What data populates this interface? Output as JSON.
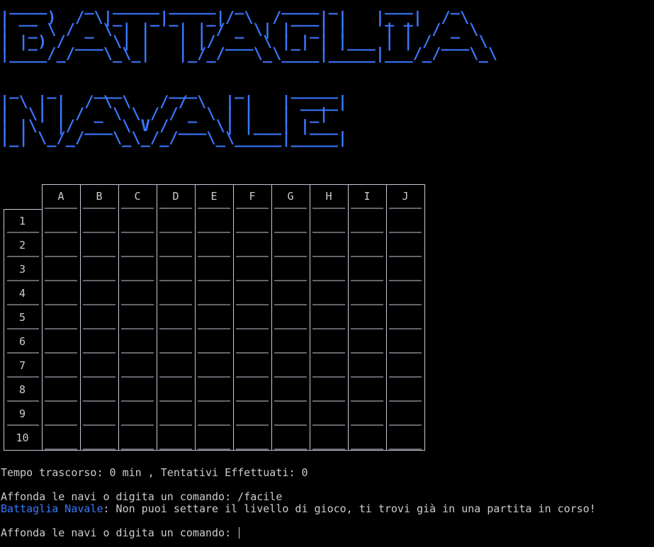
{
  "title": {
    "ascii_art": " ____    _  _____ _____  _    ____ _     ___    _    \n| __ )  / \\|_   _|_   _|/ \\  / ___| |   |_ _|  / \\   \n|  _ \\ / _ \\ | |   | | / _ \\| |  _| |    | |  / _ \\  \n| |_) / ___ \\| |   | |/ ___ \\ |_| | |___ | | / ___ \\ \n|____/_/   \\_\\_|   |_/_/   \\_\\____|_____|___/_/   \\_\\\n\n\n _   _    ___     ___    _     _____ \n| \\ | |  / \\ \\   / / \\  | |   | ____|\n|  \\| | / _ \\ \\ / / _ \\ | |   |  _|  \n| |\\  |/ ___ \\ V / ___ \\| |___| |___ \n|_| \\_/_/   \\_\\_/_/   \\_\\_____|_____|"
  },
  "board": {
    "columns": [
      "A",
      "B",
      "C",
      "D",
      "E",
      "F",
      "G",
      "H",
      "I",
      "J"
    ],
    "rows": [
      "1",
      "2",
      "3",
      "4",
      "5",
      "6",
      "7",
      "8",
      "9",
      "10"
    ]
  },
  "status": {
    "line": "Tempo trascorso: 0 min , Tentativi Effettuati: 0"
  },
  "console": {
    "prompt1": "Affonda le navi o digita un comando: ",
    "command1": "/facile",
    "app_name": "Battaglia Navale",
    "message": ": Non puoi settare il livello di gioco, ti trovi già in una partita in corso!",
    "prompt2": "Affonda le navi o digita un comando: "
  },
  "colors": {
    "accent": "#3a78ff",
    "text": "#cccccc",
    "background": "#000000"
  }
}
